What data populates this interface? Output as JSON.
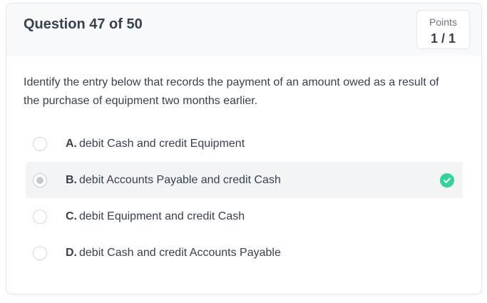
{
  "header": {
    "question_title": "Question 47 of 50",
    "points_label": "Points",
    "points_value": "1 / 1"
  },
  "question": {
    "prompt": "Identify the entry below that records the payment of an amount owed as a result of the purchase of equipment two months earlier."
  },
  "options": [
    {
      "letter": "A.",
      "text": "debit Cash and credit Equipment",
      "selected": false,
      "correct": false
    },
    {
      "letter": "B.",
      "text": "debit Accounts Payable and credit Cash",
      "selected": true,
      "correct": true
    },
    {
      "letter": "C.",
      "text": "debit Equipment and credit Cash",
      "selected": false,
      "correct": false
    },
    {
      "letter": "D.",
      "text": "debit Cash and credit Accounts Payable",
      "selected": false,
      "correct": false
    }
  ],
  "icons": {
    "correct": "check-circle-icon"
  },
  "colors": {
    "correct_green": "#34d399",
    "selected_background": "#f3f4f6",
    "header_background": "#f8f9fa"
  }
}
